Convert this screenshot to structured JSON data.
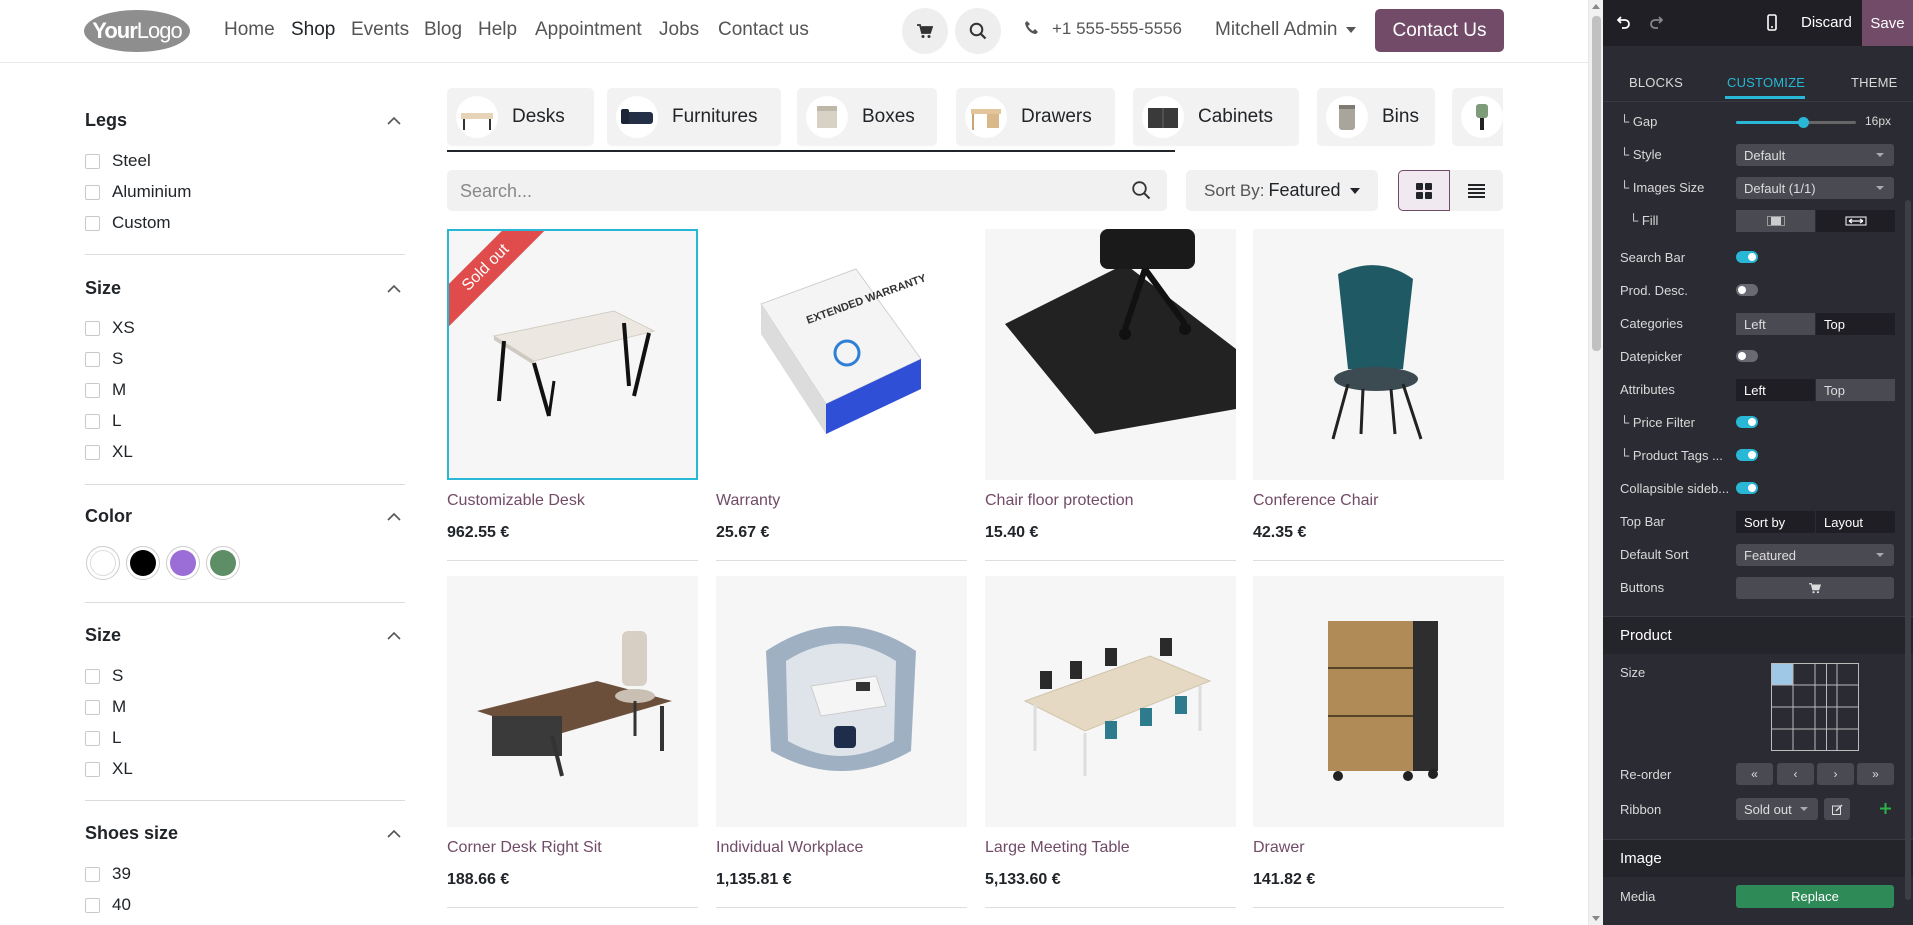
{
  "header": {
    "logo": {
      "bold": "Your",
      "light": "Logo"
    },
    "nav": [
      "Home",
      "Shop",
      "Events",
      "Blog",
      "Help",
      "Appointment",
      "Jobs",
      "Contact us"
    ],
    "active_nav": "Shop",
    "phone": "+1 555-555-5556",
    "user": "Mitchell Admin",
    "contact_button": "Contact Us"
  },
  "filters": {
    "legs": {
      "title": "Legs",
      "options": [
        "Steel",
        "Aluminium",
        "Custom"
      ]
    },
    "size": {
      "title": "Size",
      "options": [
        "XS",
        "S",
        "M",
        "L",
        "XL"
      ]
    },
    "color": {
      "title": "Color",
      "swatches": [
        "#ffffff",
        "#000000",
        "#9b6dd6",
        "#5e8e66"
      ]
    },
    "size2": {
      "title": "Size",
      "options": [
        "S",
        "M",
        "L",
        "XL"
      ]
    },
    "shoes": {
      "title": "Shoes size",
      "options": [
        "39",
        "40"
      ]
    }
  },
  "categories": [
    "Desks",
    "Furnitures",
    "Boxes",
    "Drawers",
    "Cabinets",
    "Bins"
  ],
  "search": {
    "placeholder": "Search..."
  },
  "sort": {
    "label": "Sort By:",
    "value": "Featured"
  },
  "products": [
    {
      "name": "Customizable Desk",
      "price": "962.55 €",
      "ribbon": "Sold out"
    },
    {
      "name": "Warranty",
      "price": "25.67 €",
      "box_text": "EXTENDED WARRANTY"
    },
    {
      "name": "Chair floor protection",
      "price": "15.40 €"
    },
    {
      "name": "Conference Chair",
      "price": "42.35 €"
    },
    {
      "name": "Corner Desk Right Sit",
      "price": "188.66 €"
    },
    {
      "name": "Individual Workplace",
      "price": "1,135.81 €"
    },
    {
      "name": "Large Meeting Table",
      "price": "5,133.60 €"
    },
    {
      "name": "Drawer",
      "price": "141.82 €"
    }
  ],
  "editor": {
    "discard": "Discard",
    "save": "Save",
    "tabs": [
      "BLOCKS",
      "CUSTOMIZE",
      "THEME"
    ],
    "active_tab": "CUSTOMIZE",
    "gap": {
      "label": "└ Gap",
      "value": "16px"
    },
    "style": {
      "label": "└ Style",
      "value": "Default"
    },
    "images_size": {
      "label": "└ Images Size",
      "value": "Default (1/1)"
    },
    "fill": {
      "label": "└ Fill"
    },
    "search_bar": {
      "label": "Search Bar",
      "on": true
    },
    "prod_desc": {
      "label": "Prod. Desc.",
      "on": false
    },
    "categories": {
      "label": "Categories",
      "options": [
        "Left",
        "Top"
      ]
    },
    "datepicker": {
      "label": "Datepicker",
      "on": false
    },
    "attributes": {
      "label": "Attributes",
      "options": [
        "Left",
        "Top"
      ]
    },
    "price_filter": {
      "label": "└ Price Filter",
      "on": true
    },
    "product_tags": {
      "label": "└ Product Tags ...",
      "on": true
    },
    "collapsible": {
      "label": "Collapsible sideb...",
      "on": true
    },
    "top_bar": {
      "label": "Top Bar",
      "options": [
        "Sort by",
        "Layout"
      ]
    },
    "default_sort": {
      "label": "Default Sort",
      "value": "Featured"
    },
    "buttons": {
      "label": "Buttons"
    },
    "product_section": "Product",
    "size": {
      "label": "Size"
    },
    "reorder": {
      "label": "Re-order",
      "buttons": [
        "«",
        "‹",
        "›",
        "»"
      ]
    },
    "ribbon": {
      "label": "Ribbon",
      "value": "Sold out"
    },
    "image_section": "Image",
    "media": {
      "label": "Media",
      "button": "Replace"
    }
  }
}
